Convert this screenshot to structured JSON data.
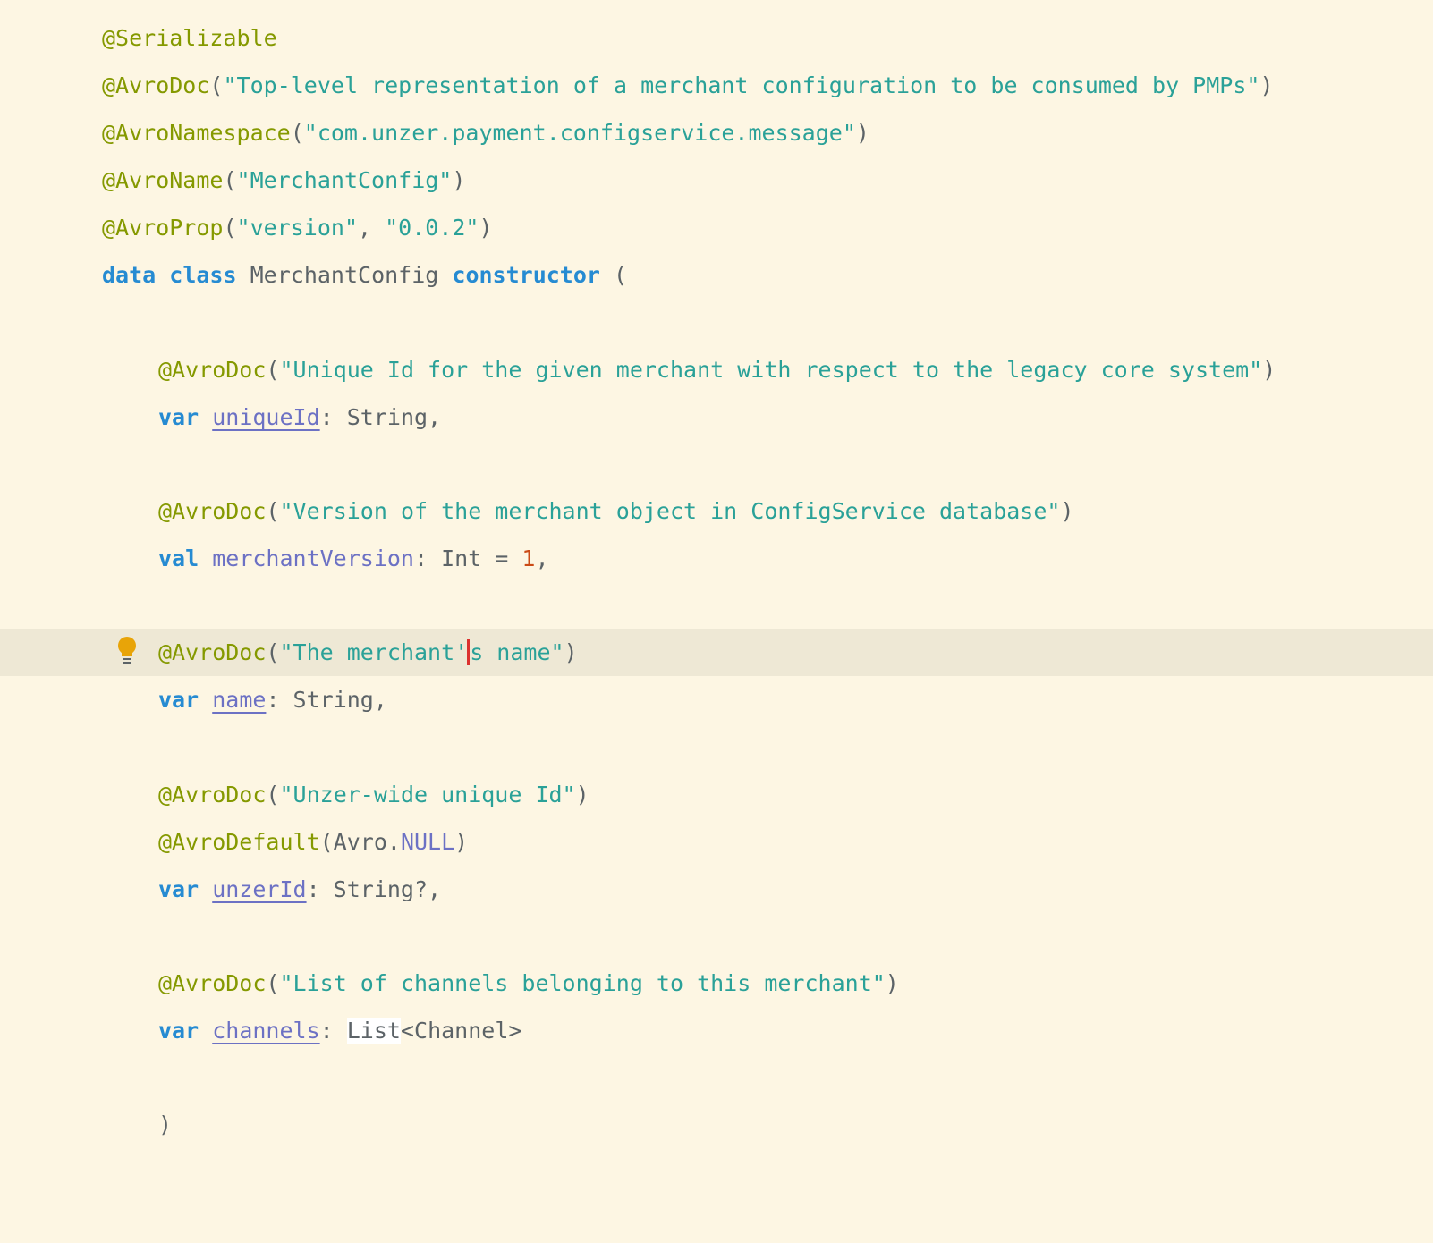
{
  "lines": {
    "l1": {
      "ann": "@Serializable"
    },
    "l2": {
      "ann": "@AvroDoc",
      "open": "(",
      "str": "\"Top-level representation of a merchant configuration to be consumed by PMPs\"",
      "close": ")"
    },
    "l3": {
      "ann": "@AvroNamespace",
      "open": "(",
      "str": "\"com.unzer.payment.configservice.message\"",
      "close": ")"
    },
    "l4": {
      "ann": "@AvroName",
      "open": "(",
      "str": "\"MerchantConfig\"",
      "close": ")"
    },
    "l5": {
      "ann": "@AvroProp",
      "open": "(",
      "str1": "\"version\"",
      "sep": ", ",
      "str2": "\"0.0.2\"",
      "close": ")"
    },
    "l6": {
      "kw1": "data",
      "kw2": "class",
      "name": "MerchantConfig",
      "kw3": "constructor",
      "paren": "("
    },
    "l8": {
      "ann": "@AvroDoc",
      "open": "(",
      "str": "\"Unique Id for the given merchant with respect to the legacy core system\"",
      "close": ")"
    },
    "l9": {
      "kw": "var",
      "prop": "uniqueId",
      "rest": ": String,"
    },
    "l11": {
      "ann": "@AvroDoc",
      "open": "(",
      "str": "\"Version of the merchant object in ConfigService database\"",
      "close": ")"
    },
    "l12": {
      "kw": "val",
      "prop": "merchantVersion",
      "rest": ": Int = ",
      "num": "1",
      "end": ","
    },
    "l14": {
      "ann": "@AvroDoc",
      "open": "(",
      "str_before_caret": "\"The merchant'",
      "str_after_caret": "s name\"",
      "close": ")"
    },
    "l15": {
      "kw": "var",
      "prop": "name",
      "rest": ": String,"
    },
    "l17": {
      "ann": "@AvroDoc",
      "open": "(",
      "str": "\"Unzer-wide unique Id\"",
      "close": ")"
    },
    "l18": {
      "ann": "@AvroDefault",
      "open": "(Avro.",
      "const": "NULL",
      "close": ")"
    },
    "l19": {
      "kw": "var",
      "prop": "unzerId",
      "rest": ": String?,"
    },
    "l21": {
      "ann": "@AvroDoc",
      "open": "(",
      "str": "\"List of channels belonging to this merchant\"",
      "close": ")"
    },
    "l22": {
      "kw": "var",
      "prop": "channels",
      "sep": ": ",
      "type_hl": "List",
      "rest": "<Channel>"
    },
    "l24": {
      "paren": ")"
    }
  },
  "icons": {
    "intention": "lightbulb-icon"
  },
  "colors": {
    "background": "#fdf6e3",
    "current_line": "#eee8d5",
    "annotation": "#859900",
    "string": "#2aa198",
    "keyword": "#268bd2",
    "property": "#6c71c4",
    "number": "#cb4b16",
    "caret": "#dc322f",
    "bulb": "#e8a408"
  }
}
